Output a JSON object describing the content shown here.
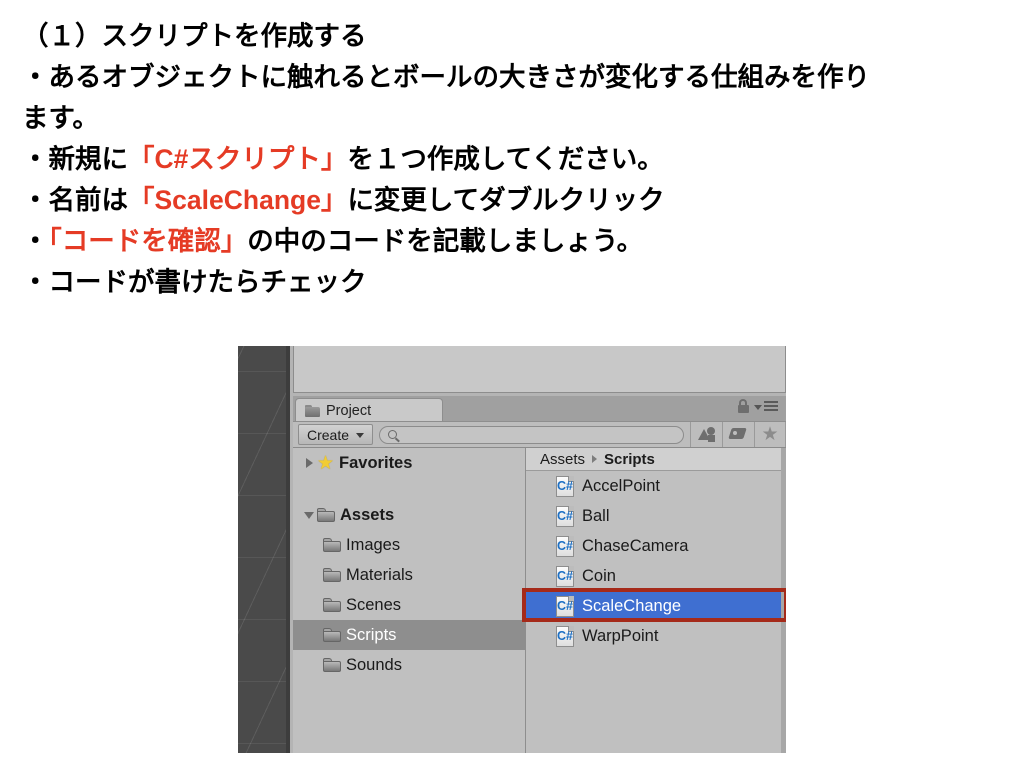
{
  "slide": {
    "lines": [
      {
        "id": "l1",
        "segments": [
          {
            "text": "（１）スクリプトを作成する",
            "color": "black"
          }
        ]
      },
      {
        "id": "l2",
        "segments": [
          {
            "text": "・あるオブジェクトに触れるとボールの大きさが変化する仕組みを作り",
            "color": "black"
          }
        ]
      },
      {
        "id": "l3",
        "segments": [
          {
            "text": "ます。",
            "color": "black"
          }
        ]
      },
      {
        "id": "l4",
        "segments": [
          {
            "text": "・新規に",
            "color": "black"
          },
          {
            "text": "「C#スクリプト」",
            "color": "red"
          },
          {
            "text": "を１つ作成してください。",
            "color": "black"
          }
        ]
      },
      {
        "id": "l5",
        "segments": [
          {
            "text": "・名前は",
            "color": "black"
          },
          {
            "text": "「ScaleChange」",
            "color": "red"
          },
          {
            "text": "に変更してダブルクリック",
            "color": "black"
          }
        ]
      },
      {
        "id": "l6",
        "segments": [
          {
            "text": "・",
            "color": "black"
          },
          {
            "text": "「コードを確認」",
            "color": "red"
          },
          {
            "text": "の中のコードを記載しましょう。",
            "color": "black"
          }
        ]
      },
      {
        "id": "l7",
        "segments": [
          {
            "text": "・コードが書けたらチェック",
            "color": "black"
          }
        ]
      }
    ],
    "accent_color": "#E53B25",
    "text_color": "#000000"
  },
  "unity": {
    "tab": {
      "label": "Project",
      "icon": "folder-icon",
      "lock_icon": "lock-icon",
      "menu_icon": "hamburger-menu-icon"
    },
    "toolbar": {
      "create_label": "Create",
      "create_caret": "chevron-down-icon",
      "search_placeholder": "",
      "search_value": "",
      "search_icon": "search-icon",
      "filter_buttons": [
        {
          "name": "filter-by-type-button",
          "icon": "shapes-icon"
        },
        {
          "name": "filter-by-label-button",
          "icon": "tag-icon"
        },
        {
          "name": "filter-by-favorite-button",
          "icon": "star-icon"
        }
      ]
    },
    "tree": [
      {
        "label": "Favorites",
        "icon": "star-icon",
        "expanded": false,
        "indent": 0,
        "bold": true,
        "selected": false,
        "twisty": "chevron-right-icon"
      },
      {
        "label": "",
        "icon": "",
        "spacer": true,
        "indent": 0,
        "bold": false,
        "selected": false,
        "twisty": ""
      },
      {
        "label": "Assets",
        "icon": "folder-icon",
        "expanded": true,
        "indent": 0,
        "bold": true,
        "selected": false,
        "twisty": "chevron-down-icon"
      },
      {
        "label": "Images",
        "icon": "folder-icon",
        "indent": 1,
        "bold": false,
        "selected": false,
        "twisty": ""
      },
      {
        "label": "Materials",
        "icon": "folder-icon",
        "indent": 1,
        "bold": false,
        "selected": false,
        "twisty": ""
      },
      {
        "label": "Scenes",
        "icon": "folder-icon",
        "indent": 1,
        "bold": false,
        "selected": false,
        "twisty": ""
      },
      {
        "label": "Scripts",
        "icon": "folder-icon",
        "indent": 1,
        "bold": false,
        "selected": true,
        "twisty": ""
      },
      {
        "label": "Sounds",
        "icon": "folder-icon",
        "indent": 1,
        "bold": false,
        "selected": false,
        "twisty": ""
      }
    ],
    "breadcrumb": {
      "root": "Assets",
      "separator_icon": "chevron-right-icon",
      "current": "Scripts"
    },
    "files": [
      {
        "label": "AccelPoint",
        "icon": "csharp-script-icon",
        "selected": false
      },
      {
        "label": "Ball",
        "icon": "csharp-script-icon",
        "selected": false
      },
      {
        "label": "ChaseCamera",
        "icon": "csharp-script-icon",
        "selected": false
      },
      {
        "label": "Coin",
        "icon": "csharp-script-icon",
        "selected": false
      },
      {
        "label": "ScaleChange",
        "icon": "csharp-script-icon",
        "selected": true
      },
      {
        "label": "WarpPoint",
        "icon": "csharp-script-icon",
        "selected": false
      }
    ],
    "annotation": {
      "target": "ScaleChange",
      "color": "#A52A1A"
    },
    "colors": {
      "selection_blue": "#3F6FD1",
      "tree_selection_gray": "#8E8E8E",
      "panel_gray": "#C0C0C0",
      "toolbar_gray": "#BDBDBD",
      "scene_dark": "#4A4A4A"
    },
    "csharp_symbol": "C#"
  }
}
